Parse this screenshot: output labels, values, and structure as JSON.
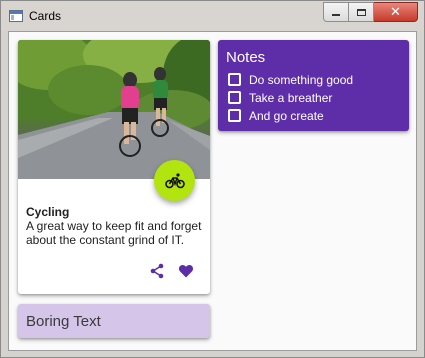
{
  "window": {
    "title": "Cards",
    "controls": {
      "minimize_icon": "minimize-icon",
      "maximize_icon": "maximize-icon",
      "close_icon": "close-icon",
      "close_glyph": "✕"
    }
  },
  "cycling_card": {
    "image": "cycling-photo",
    "fab_icon": "bicycle-icon",
    "fab_color": "#b2e40f",
    "heading": "Cycling",
    "body": "A great way to keep fit and forget about the constant grind of IT.",
    "actions": [
      {
        "name": "share",
        "icon": "share-icon"
      },
      {
        "name": "favorite",
        "icon": "heart-icon"
      }
    ],
    "accent_color": "#5e2ea8"
  },
  "notes_card": {
    "title": "Notes",
    "background": "#5e2ea8",
    "items": [
      {
        "label": "Do something good",
        "checked": false
      },
      {
        "label": "Take a breather",
        "checked": false
      },
      {
        "label": "And go create",
        "checked": false
      }
    ]
  },
  "boring_card": {
    "text": "Boring Text",
    "background": "#d4c5e9"
  }
}
